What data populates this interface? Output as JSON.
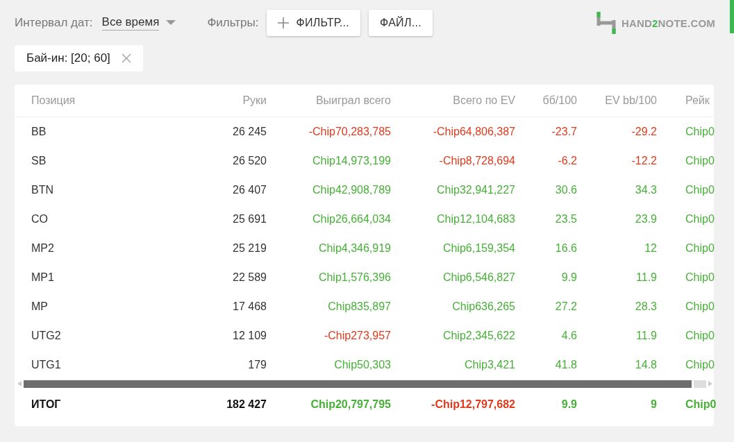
{
  "toolbar": {
    "date_label": "Интервал дат:",
    "date_value": "Все время",
    "filters_label": "Фильтры:",
    "buttons": [
      {
        "label": "ФИЛЬТР...",
        "kind": "add"
      },
      {
        "label": "ФАЙЛ...",
        "kind": "plain"
      }
    ]
  },
  "logo": {
    "text_before": "HAND",
    "accent_text": "2",
    "text_after": "NOTE.COM"
  },
  "active_filters": [
    {
      "label": "Бай-ин: [20; 60]"
    }
  ],
  "table": {
    "columns": [
      "Позиция",
      "Руки",
      "Выиграл всего",
      "Всего по EV",
      "бб/100",
      "EV bb/100",
      "Рейк"
    ],
    "rows": [
      {
        "cells": [
          {
            "text": "BB"
          },
          {
            "text": "26 245"
          },
          {
            "text": "-Chip70,283,785",
            "negative": true
          },
          {
            "text": "-Chip64,806,387",
            "negative": true
          },
          {
            "text": "-23.7",
            "negative": true
          },
          {
            "text": "-29.2",
            "negative": true
          },
          {
            "text": "Chip0",
            "negative": false
          }
        ]
      },
      {
        "cells": [
          {
            "text": "SB"
          },
          {
            "text": "26 520"
          },
          {
            "text": "Chip14,973,199",
            "negative": false
          },
          {
            "text": "-Chip8,728,694",
            "negative": true
          },
          {
            "text": "-6.2",
            "negative": true
          },
          {
            "text": "-12.2",
            "negative": true
          },
          {
            "text": "Chip0",
            "negative": false
          }
        ]
      },
      {
        "cells": [
          {
            "text": "BTN"
          },
          {
            "text": "26 407"
          },
          {
            "text": "Chip42,908,789",
            "negative": false
          },
          {
            "text": "Chip32,941,227",
            "negative": false
          },
          {
            "text": "30.6",
            "negative": false
          },
          {
            "text": "34.3",
            "negative": false
          },
          {
            "text": "Chip0",
            "negative": false
          }
        ]
      },
      {
        "cells": [
          {
            "text": "CO"
          },
          {
            "text": "25 691"
          },
          {
            "text": "Chip26,664,034",
            "negative": false
          },
          {
            "text": "Chip12,104,683",
            "negative": false
          },
          {
            "text": "23.5",
            "negative": false
          },
          {
            "text": "23.9",
            "negative": false
          },
          {
            "text": "Chip0",
            "negative": false
          }
        ]
      },
      {
        "cells": [
          {
            "text": "MP2"
          },
          {
            "text": "25 219"
          },
          {
            "text": "Chip4,346,919",
            "negative": false
          },
          {
            "text": "Chip6,159,354",
            "negative": false
          },
          {
            "text": "16.6",
            "negative": false
          },
          {
            "text": "12",
            "negative": false
          },
          {
            "text": "Chip0",
            "negative": false
          }
        ]
      },
      {
        "cells": [
          {
            "text": "MP1"
          },
          {
            "text": "22 589"
          },
          {
            "text": "Chip1,576,396",
            "negative": false
          },
          {
            "text": "Chip6,546,827",
            "negative": false
          },
          {
            "text": "9.9",
            "negative": false
          },
          {
            "text": "11.9",
            "negative": false
          },
          {
            "text": "Chip0",
            "negative": false
          }
        ]
      },
      {
        "cells": [
          {
            "text": "MP"
          },
          {
            "text": "17 468"
          },
          {
            "text": "Chip835,897",
            "negative": false
          },
          {
            "text": "Chip636,265",
            "negative": false
          },
          {
            "text": "27.2",
            "negative": false
          },
          {
            "text": "28.3",
            "negative": false
          },
          {
            "text": "Chip0",
            "negative": false
          }
        ]
      },
      {
        "cells": [
          {
            "text": "UTG2"
          },
          {
            "text": "12 109"
          },
          {
            "text": "-Chip273,957",
            "negative": true
          },
          {
            "text": "Chip2,345,622",
            "negative": false
          },
          {
            "text": "4.6",
            "negative": false
          },
          {
            "text": "11.9",
            "negative": false
          },
          {
            "text": "Chip0",
            "negative": false
          }
        ]
      },
      {
        "cells": [
          {
            "text": "UTG1"
          },
          {
            "text": "179"
          },
          {
            "text": "Chip50,303",
            "negative": false
          },
          {
            "text": "Chip3,421",
            "negative": false
          },
          {
            "text": "41.8",
            "negative": false
          },
          {
            "text": "14.8",
            "negative": false
          },
          {
            "text": "Chip0",
            "negative": false
          }
        ]
      }
    ],
    "total": {
      "cells": [
        {
          "text": "ИТОГ"
        },
        {
          "text": "182 427"
        },
        {
          "text": "Chip20,797,795",
          "negative": false
        },
        {
          "text": "-Chip12,797,682",
          "negative": true
        },
        {
          "text": "9.9",
          "negative": false
        },
        {
          "text": "9",
          "negative": false
        },
        {
          "text": "Chip0",
          "negative": false
        }
      ]
    }
  }
}
